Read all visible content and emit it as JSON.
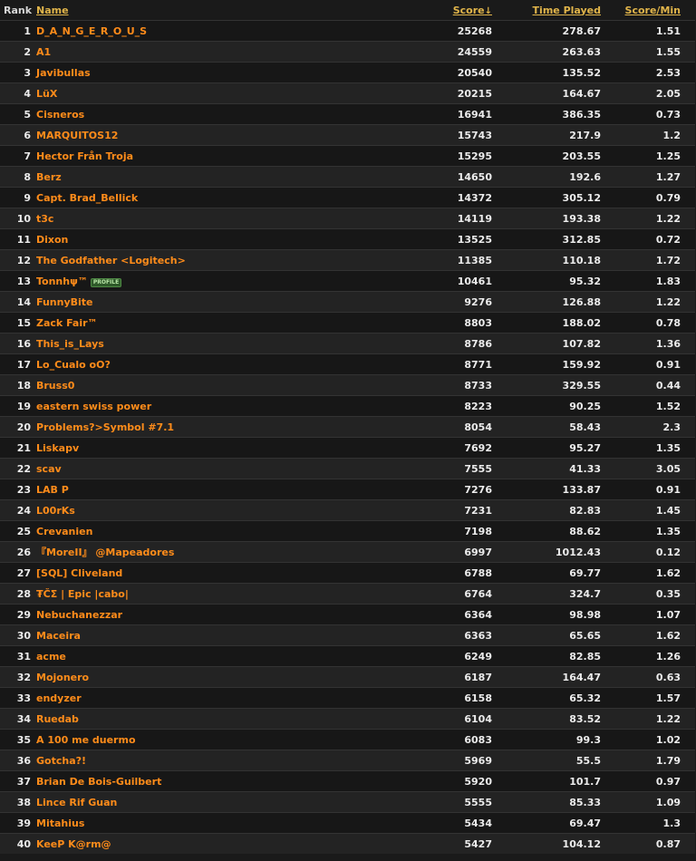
{
  "headers": {
    "rank": "Rank",
    "name": "Name",
    "score": "Score",
    "sort_arrow": "↓",
    "time": "Time Played",
    "spm": "Score/Min"
  },
  "profile_badge": "PROFILE",
  "rows": [
    {
      "rank": "1",
      "name": "D_A_N_G_E_R_O_U_S",
      "score": "25268",
      "time": "278.67",
      "spm": "1.51"
    },
    {
      "rank": "2",
      "name": "A1",
      "score": "24559",
      "time": "263.63",
      "spm": "1.55"
    },
    {
      "rank": "3",
      "name": "Javibullas",
      "score": "20540",
      "time": "135.52",
      "spm": "2.53"
    },
    {
      "rank": "4",
      "name": "LüX",
      "score": "20215",
      "time": "164.67",
      "spm": "2.05"
    },
    {
      "rank": "5",
      "name": "Cisneros",
      "score": "16941",
      "time": "386.35",
      "spm": "0.73"
    },
    {
      "rank": "6",
      "name": "MARQUITOS12",
      "score": "15743",
      "time": "217.9",
      "spm": "1.2"
    },
    {
      "rank": "7",
      "name": "Hector Från Troja",
      "score": "15295",
      "time": "203.55",
      "spm": "1.25"
    },
    {
      "rank": "8",
      "name": "Berz",
      "score": "14650",
      "time": "192.6",
      "spm": "1.27"
    },
    {
      "rank": "9",
      "name": "Capt. Brad_Bellick",
      "score": "14372",
      "time": "305.12",
      "spm": "0.79"
    },
    {
      "rank": "10",
      "name": "t3c",
      "score": "14119",
      "time": "193.38",
      "spm": "1.22"
    },
    {
      "rank": "11",
      "name": "Dixon",
      "score": "13525",
      "time": "312.85",
      "spm": "0.72"
    },
    {
      "rank": "12",
      "name": "The Godfather <Logitech>",
      "score": "11385",
      "time": "110.18",
      "spm": "1.72"
    },
    {
      "rank": "13",
      "name": "Tonnhψ™",
      "score": "10461",
      "time": "95.32",
      "spm": "1.83",
      "badge": true
    },
    {
      "rank": "14",
      "name": "FunnyBite",
      "score": "9276",
      "time": "126.88",
      "spm": "1.22"
    },
    {
      "rank": "15",
      "name": "Zack Fair™",
      "score": "8803",
      "time": "188.02",
      "spm": "0.78"
    },
    {
      "rank": "16",
      "name": "This_is_Lays",
      "score": "8786",
      "time": "107.82",
      "spm": "1.36"
    },
    {
      "rank": "17",
      "name": "Lo_Cualo oO?",
      "score": "8771",
      "time": "159.92",
      "spm": "0.91"
    },
    {
      "rank": "18",
      "name": "Bruss0",
      "score": "8733",
      "time": "329.55",
      "spm": "0.44"
    },
    {
      "rank": "19",
      "name": "eastern swiss power",
      "score": "8223",
      "time": "90.25",
      "spm": "1.52"
    },
    {
      "rank": "20",
      "name": "Problems?>Symbol #7.1",
      "score": "8054",
      "time": "58.43",
      "spm": "2.3"
    },
    {
      "rank": "21",
      "name": "Liskapv",
      "score": "7692",
      "time": "95.27",
      "spm": "1.35"
    },
    {
      "rank": "22",
      "name": "scav",
      "score": "7555",
      "time": "41.33",
      "spm": "3.05"
    },
    {
      "rank": "23",
      "name": "LAB P",
      "score": "7276",
      "time": "133.87",
      "spm": "0.91"
    },
    {
      "rank": "24",
      "name": "L00rKs",
      "score": "7231",
      "time": "82.83",
      "spm": "1.45"
    },
    {
      "rank": "25",
      "name": "Crevanien",
      "score": "7198",
      "time": "88.62",
      "spm": "1.35"
    },
    {
      "rank": "26",
      "name": "『MoreII』 @Mapeadores",
      "score": "6997",
      "time": "1012.43",
      "spm": "0.12"
    },
    {
      "rank": "27",
      "name": "[SQL] Cliveland",
      "score": "6788",
      "time": "69.77",
      "spm": "1.62"
    },
    {
      "rank": "28",
      "name": "₮ČΣ | Epic |cabo|",
      "score": "6764",
      "time": "324.7",
      "spm": "0.35"
    },
    {
      "rank": "29",
      "name": "Nebuchanezzar",
      "score": "6364",
      "time": "98.98",
      "spm": "1.07"
    },
    {
      "rank": "30",
      "name": "Maceira",
      "score": "6363",
      "time": "65.65",
      "spm": "1.62"
    },
    {
      "rank": "31",
      "name": "acme",
      "score": "6249",
      "time": "82.85",
      "spm": "1.26"
    },
    {
      "rank": "32",
      "name": "Mojonero",
      "score": "6187",
      "time": "164.47",
      "spm": "0.63"
    },
    {
      "rank": "33",
      "name": "endyzer",
      "score": "6158",
      "time": "65.32",
      "spm": "1.57"
    },
    {
      "rank": "34",
      "name": "Ruedab",
      "score": "6104",
      "time": "83.52",
      "spm": "1.22"
    },
    {
      "rank": "35",
      "name": "A 100 me duermo",
      "score": "6083",
      "time": "99.3",
      "spm": "1.02"
    },
    {
      "rank": "36",
      "name": "Gotcha?!",
      "score": "5969",
      "time": "55.5",
      "spm": "1.79"
    },
    {
      "rank": "37",
      "name": "Brian De Bois-Guilbert",
      "score": "5920",
      "time": "101.7",
      "spm": "0.97"
    },
    {
      "rank": "38",
      "name": "Lince Rif Guan",
      "score": "5555",
      "time": "85.33",
      "spm": "1.09"
    },
    {
      "rank": "39",
      "name": "Mitahius",
      "score": "5434",
      "time": "69.47",
      "spm": "1.3"
    },
    {
      "rank": "40",
      "name": "KeeP K@rm@",
      "score": "5427",
      "time": "104.12",
      "spm": "0.87"
    }
  ]
}
